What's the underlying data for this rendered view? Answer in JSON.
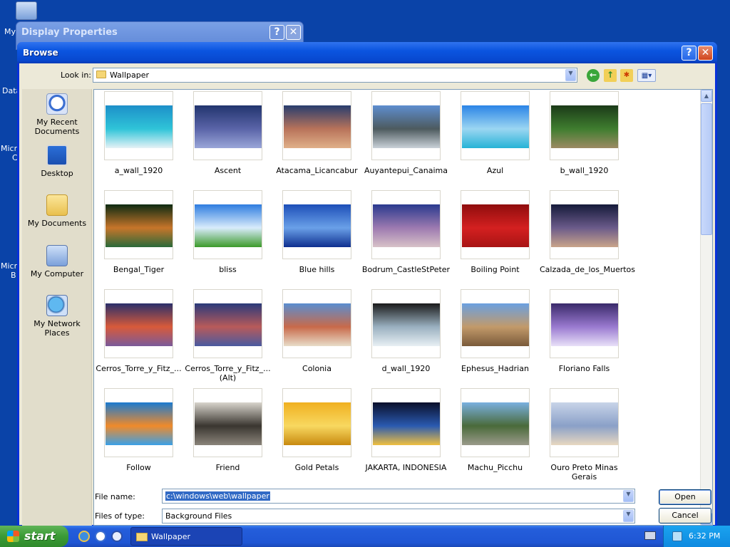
{
  "desktop": {
    "icons": [
      {
        "label": "My",
        "icon": "my-computer-icon"
      },
      {
        "label": "Data",
        "icon": "database-icon"
      },
      {
        "label": "Micro",
        "icon": "app-icon"
      },
      {
        "label": "Micro",
        "icon": "app-icon"
      }
    ],
    "icon_sublabels": [
      "C",
      "B"
    ]
  },
  "display_properties": {
    "title": "Display Properties",
    "help_glyph": "?",
    "close_glyph": "✕"
  },
  "browse": {
    "title": "Browse",
    "help_glyph": "?",
    "close_glyph": "✕",
    "look_in_label": "Look in:",
    "look_in_value": "Wallpaper",
    "toolbar_icons": [
      "back-icon",
      "up-folder-icon",
      "new-folder-icon",
      "view-menu-icon"
    ],
    "places": [
      {
        "label": "My Recent Documents",
        "icon": "recent-documents-icon"
      },
      {
        "label": "Desktop",
        "icon": "desktop-icon"
      },
      {
        "label": "My Documents",
        "icon": "my-documents-icon"
      },
      {
        "label": "My Computer",
        "icon": "my-computer-icon"
      },
      {
        "label": "My Network Places",
        "icon": "network-places-icon"
      }
    ],
    "files": [
      {
        "name": "a_wall_1920",
        "colors": [
          "#1d8fc9",
          "#2fc4d8",
          "#e6f2f6"
        ]
      },
      {
        "name": "Ascent",
        "colors": [
          "#22356e",
          "#5a64a8",
          "#9aa6d8"
        ]
      },
      {
        "name": "Atacama_Licancabur",
        "colors": [
          "#283d6e",
          "#b8735a",
          "#e0b089"
        ]
      },
      {
        "name": "Auyantepui_Canaima",
        "colors": [
          "#5e8ecf",
          "#4d5a5e",
          "#c9d1d8"
        ]
      },
      {
        "name": "Azul",
        "colors": [
          "#2b84e6",
          "#9bd6f2",
          "#26b3d6"
        ]
      },
      {
        "name": "b_wall_1920",
        "colors": [
          "#1b3a18",
          "#3f7d2f",
          "#9c8a63"
        ]
      },
      {
        "name": "Bengal_Tiger",
        "colors": [
          "#0d2b12",
          "#c7752a",
          "#2a6a3a"
        ]
      },
      {
        "name": "bliss",
        "colors": [
          "#2f7de0",
          "#d9ecfb",
          "#3c9a2a"
        ]
      },
      {
        "name": "Blue hills",
        "colors": [
          "#1d4fb8",
          "#6aa0e8",
          "#0e2f8f"
        ]
      },
      {
        "name": "Bodrum_CastleStPeter",
        "colors": [
          "#2a3a8e",
          "#9d7ab0",
          "#d8c2c8"
        ]
      },
      {
        "name": "Boiling Point",
        "colors": [
          "#8f0d0d",
          "#d42020",
          "#a81414"
        ]
      },
      {
        "name": "Calzada_de_los_Muertos",
        "colors": [
          "#151a3a",
          "#6b5b8a",
          "#c9a48a"
        ]
      },
      {
        "name": "Cerros_Torre_y_Fitz_...",
        "colors": [
          "#2a2f6a",
          "#d85a3a",
          "#7a5a9a"
        ]
      },
      {
        "name": "Cerros_Torre_y_Fitz_... (Alt)",
        "colors": [
          "#2a3a7a",
          "#b85a5a",
          "#4a5aa0"
        ]
      },
      {
        "name": "Colonia",
        "colors": [
          "#5a8ed0",
          "#c86a4a",
          "#e8dcc8"
        ]
      },
      {
        "name": "d_wall_1920",
        "colors": [
          "#1a1a1a",
          "#9ab0c0",
          "#e8f0f4"
        ]
      },
      {
        "name": "Ephesus_Hadrian",
        "colors": [
          "#6ba0e0",
          "#c29a6a",
          "#7a5a3a"
        ]
      },
      {
        "name": "Floriano Falls",
        "colors": [
          "#3a2a6a",
          "#9a7ad0",
          "#e8e0f8"
        ]
      },
      {
        "name": "Follow",
        "colors": [
          "#1a7ad0",
          "#f08a2a",
          "#3aa0e8"
        ]
      },
      {
        "name": "Friend",
        "colors": [
          "#d8d4cc",
          "#3a3630",
          "#8a847a"
        ]
      },
      {
        "name": "Gold Petals",
        "colors": [
          "#f0b020",
          "#f8d860",
          "#c88a10"
        ]
      },
      {
        "name": "JAKARTA, INDONESIA",
        "colors": [
          "#0a0f2a",
          "#2a5ab0",
          "#f0c040"
        ]
      },
      {
        "name": "Machu_Picchu",
        "colors": [
          "#7ab0e0",
          "#4a6a3a",
          "#9a9a8a"
        ]
      },
      {
        "name": "Ouro Preto Minas Gerais",
        "colors": [
          "#c8d4e8",
          "#8aa0c8",
          "#e8d8c0"
        ]
      }
    ],
    "file_name_label": "File name:",
    "file_name_value": "c:\\windows\\web\\wallpaper",
    "files_of_type_label": "Files of type:",
    "files_of_type_value": "Background Files",
    "open_label": "Open",
    "cancel_label": "Cancel"
  },
  "taskbar": {
    "start_label": "start",
    "quick_launch": [
      "internet-explorer-icon",
      "media-icon",
      "show-desktop-icon"
    ],
    "task_label": "Wallpaper",
    "clock": "6:32 PM"
  },
  "colors": {
    "desktop_bg": "#0a43a8",
    "title_blue": "#0b55e0",
    "dialog_bg": "#ece9d8",
    "selection": "#316ac5"
  }
}
